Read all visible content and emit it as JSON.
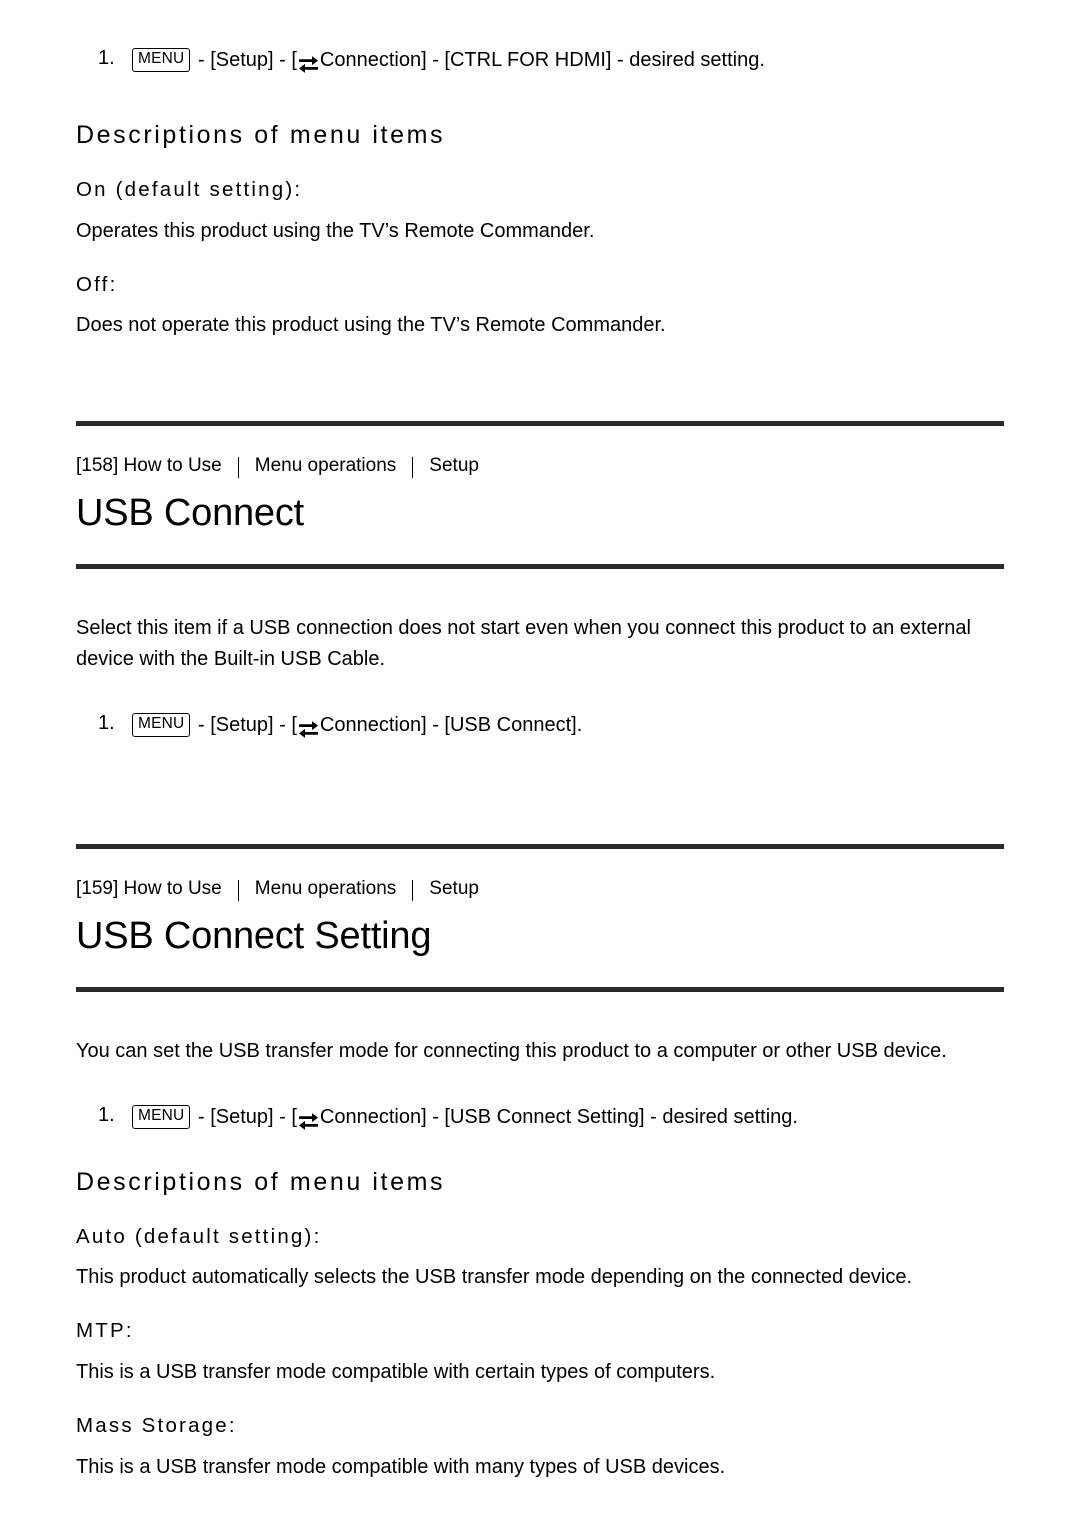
{
  "icons": {
    "menu_key_label": "MENU",
    "connection_icon_name": "two-way-arrows-icon"
  },
  "step_number": "1.",
  "sections": [
    {
      "id": "ctrl-for-hdmi-tail",
      "step": {
        "number": "1.",
        "before_icon": " - [Setup] - [",
        "after_icon": "Connection] - [CTRL FOR HDMI] - desired setting."
      },
      "desc_heading": "Descriptions of menu items",
      "items": [
        {
          "label": "On (default setting):",
          "text": "Operates this product using the TV’s Remote Commander."
        },
        {
          "label": "Off:",
          "text": "Does not operate this product using the TV’s Remote Commander."
        }
      ]
    },
    {
      "id": "usb-connect",
      "breadcrumb": {
        "index": "[158] How to Use",
        "middle": "Menu operations",
        "last": "Setup"
      },
      "title": "USB Connect",
      "body": "Select this item if a USB connection does not start even when you connect this product to an external device with the Built-in USB Cable.",
      "step": {
        "number": "1.",
        "before_icon": " - [Setup] - [",
        "after_icon": "Connection] - [USB Connect]."
      }
    },
    {
      "id": "usb-connect-setting",
      "breadcrumb": {
        "index": "[159] How to Use",
        "middle": "Menu operations",
        "last": "Setup"
      },
      "title": "USB Connect Setting",
      "body": "You can set the USB transfer mode for connecting this product to a computer or other USB device.",
      "step": {
        "number": "1.",
        "before_icon": " - [Setup] - [",
        "after_icon": "Connection] - [USB Connect Setting] - desired setting."
      },
      "desc_heading": "Descriptions of menu items",
      "items": [
        {
          "label": "Auto (default setting):",
          "text": "This product automatically selects the USB transfer mode depending on the connected device."
        },
        {
          "label": "MTP:",
          "text": "This is a USB transfer mode compatible with certain types of computers."
        },
        {
          "label": "Mass Storage:",
          "text": "This is a USB transfer mode compatible with many types of USB devices."
        }
      ]
    }
  ],
  "colors": {
    "text": "#000000",
    "rule": "#2b2b2b",
    "background": "#ffffff"
  }
}
